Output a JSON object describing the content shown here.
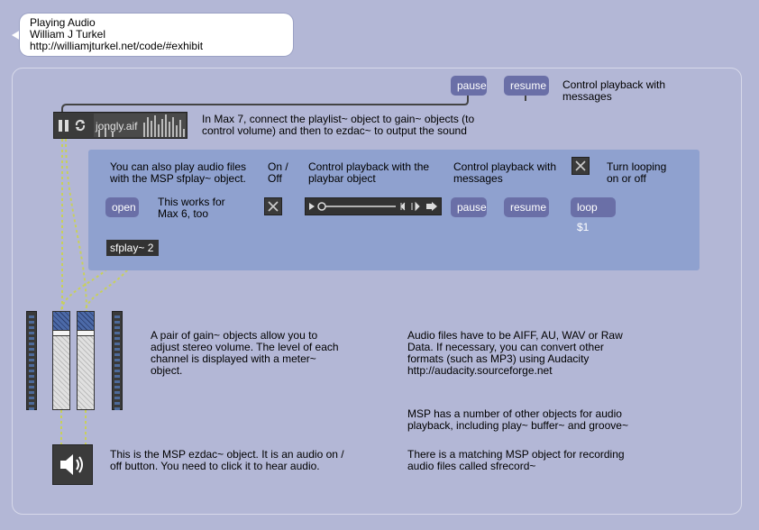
{
  "comment_bubble": {
    "lines": "Playing Audio\nWilliam J Turkel\nhttp://williamjturkel.net/code/#exhibit"
  },
  "top": {
    "pause_label": "pause",
    "resume_label": "resume",
    "messages_note": "Control playback with\nmessages",
    "playlist_file": "jongly.aif",
    "max7_note": "In Max 7, connect the playlist~ object to gain~ objects (to\ncontrol volume) and then to ezdac~ to output the sound"
  },
  "panel": {
    "sfplay_note": "You can also play audio files\nwith the MSP sfplay~ object.",
    "onoff_note": "On /\nOff",
    "playbar_note": "Control playback with the\nplaybar object",
    "messages_note": "Control playback with\nmessages",
    "loop_note": "Turn looping\non or off",
    "open_label": "open",
    "max6_note": "This works for\nMax 6, too",
    "pause_label": "pause",
    "resume_label": "resume",
    "loop_label": "loop $1",
    "sfplay_object": "sfplay~ 2"
  },
  "notes": {
    "gain_note": "A pair of gain~ objects allow you to\nadjust stereo volume. The level of each\nchannel is displayed with a meter~\nobject.",
    "formats_note": "Audio files have to be AIFF, AU, WAV or Raw\nData. If necessary, you can convert other\nformats (such as MP3) using Audacity\nhttp://audacity.sourceforge.net",
    "other_objects_note": "MSP has a number of other objects for audio\nplayback, including play~ buffer~ and groove~",
    "ezdac_note": "This is the MSP ezdac~ object. It is an audio on /\noff button. You need to click it to hear audio.",
    "sfrecord_note": "There is a matching MSP object for recording\naudio files called sfrecord~"
  },
  "icons": {
    "ezdac": "speaker-icon",
    "playlist_pause": "pause-icon",
    "playlist_loop": "loop-icon",
    "toggle": "x-icon"
  },
  "colors": {
    "background": "#b3b7d6",
    "panel": "#8fa1cf",
    "message_box": "#6a6fa7",
    "object": "#333333",
    "patch_cord_audio": "#c8d05c"
  },
  "gain": {
    "left_level": 0.8,
    "right_level": 0.8
  }
}
